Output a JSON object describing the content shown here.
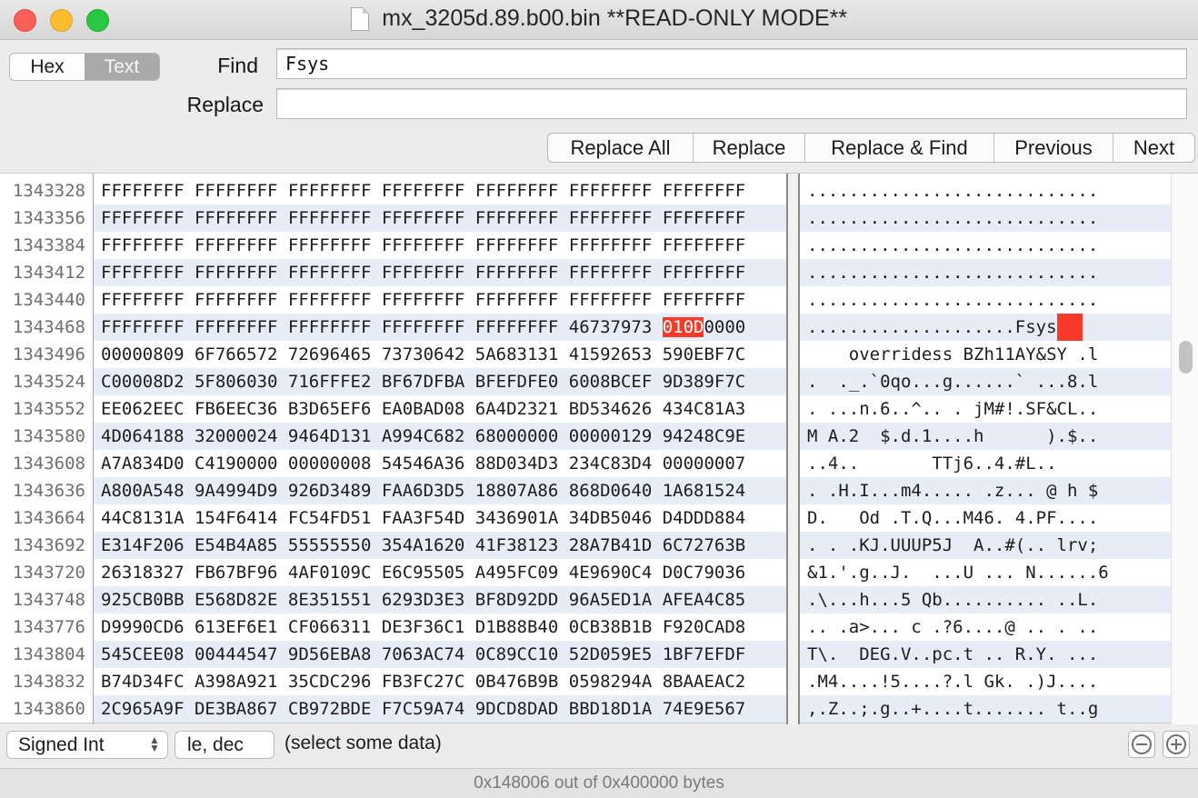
{
  "window": {
    "title": "mx_3205d.89.b00.bin **READ-ONLY MODE**"
  },
  "toolbar": {
    "mode_hex": "Hex",
    "mode_text": "Text",
    "find_label": "Find",
    "find_value": "Fsys",
    "replace_label": "Replace",
    "replace_value": "",
    "buttons": [
      "Replace All",
      "Replace",
      "Replace & Find",
      "Previous",
      "Next"
    ]
  },
  "hex_view": {
    "rows": [
      {
        "offset": "1343328",
        "hex": "FFFFFFFF FFFFFFFF FFFFFFFF FFFFFFFF FFFFFFFF FFFFFFFF FFFFFFFF",
        "ascii": "............................"
      },
      {
        "offset": "1343356",
        "hex": "FFFFFFFF FFFFFFFF FFFFFFFF FFFFFFFF FFFFFFFF FFFFFFFF FFFFFFFF",
        "ascii": "............................"
      },
      {
        "offset": "1343384",
        "hex": "FFFFFFFF FFFFFFFF FFFFFFFF FFFFFFFF FFFFFFFF FFFFFFFF FFFFFFFF",
        "ascii": "............................"
      },
      {
        "offset": "1343412",
        "hex": "FFFFFFFF FFFFFFFF FFFFFFFF FFFFFFFF FFFFFFFF FFFFFFFF FFFFFFFF",
        "ascii": "............................"
      },
      {
        "offset": "1343440",
        "hex": "FFFFFFFF FFFFFFFF FFFFFFFF FFFFFFFF FFFFFFFF FFFFFFFF FFFFFFFF",
        "ascii": "............................"
      },
      {
        "offset": "1343468",
        "hex_pre": "FFFFFFFF FFFFFFFF FFFFFFFF FFFFFFFF FFFFFFFF 46737973 ",
        "hex_hl": "010D",
        "hex_post": "0000",
        "ascii": "....................Fsys",
        "ascii_hl": true
      },
      {
        "offset": "1343496",
        "hex": "00000809 6F766572 72696465 73730642 5A683131 41592653 590EBF7C",
        "ascii": "    overridess BZh11AY&SY .l"
      },
      {
        "offset": "1343524",
        "hex": "C00008D2 5F806030 716FFFE2 BF67DFBA BFEFDFE0 6008BCEF 9D389F7C",
        "ascii": ".  ._.`0qo...g......` ...8.l"
      },
      {
        "offset": "1343552",
        "hex": "EE062EEC FB6EEC36 B3D65EF6 EA0BAD08 6A4D2321 BD534626 434C81A3",
        "ascii": ". ...n.6..^.. . jM#!.SF&CL.."
      },
      {
        "offset": "1343580",
        "hex": "4D064188 32000024 9464D131 A994C682 68000000 00000129 94248C9E",
        "ascii": "M A.2  $.d.1....h      ).$.."
      },
      {
        "offset": "1343608",
        "hex": "A7A834D0 C4190000 00000008 54546A36 88D034D3 234C83D4 00000007",
        "ascii": "..4..       TTj6..4.#L..    "
      },
      {
        "offset": "1343636",
        "hex": "A800A548 9A4994D9 926D3489 FAA6D3D5 18807A86 868D0640 1A681524",
        "ascii": ". .H.I...m4..... .z... @ h $"
      },
      {
        "offset": "1343664",
        "hex": "44C8131A 154F6414 FC54FD51 FAA3F54D 3436901A 34DB5046 D4DDD884",
        "ascii": "D.   Od .T.Q...M46. 4.PF...."
      },
      {
        "offset": "1343692",
        "hex": "E314F206 E54B4A85 55555550 354A1620 41F38123 28A7B41D 6C72763B",
        "ascii": ". . .KJ.UUUP5J  A..#(.. lrv;"
      },
      {
        "offset": "1343720",
        "hex": "26318327 FB67BF96 4AF0109C E6C95505 A495FC09 4E9690C4 D0C79036",
        "ascii": "&1.'.g..J.  ...U ... N......6"
      },
      {
        "offset": "1343748",
        "hex": "925CB0BB E568D82E 8E351551 6293D3E3 BF8D92DD 96A5ED1A AFEA4C85",
        "ascii": ".\\...h...5 Qb.......... ..L."
      },
      {
        "offset": "1343776",
        "hex": "D9990CD6 613EF6E1 CF066311 DE3F36C1 D1B88B40 0CB38B1B F920CAD8",
        "ascii": ".. .a>... c .?6....@ .. . .."
      },
      {
        "offset": "1343804",
        "hex": "545CEE08 00444547 9D56EBA8 7063AC74 0C89CC10 52D059E5 1BF7EFDF",
        "ascii": "T\\.  DEG.V..pc.t .. R.Y. ..."
      },
      {
        "offset": "1343832",
        "hex": "B74D34FC A398A921 35CDC296 FB3FC27C 0B476B9B 0598294A 8BAAEAC2",
        "ascii": ".M4....!5....?.l Gk. .)J...."
      },
      {
        "offset": "1343860",
        "hex": "2C965A9F DE3BA867 CB972BDE F7C59A74 9DCD8DAD BBD18D1A 74E9E567",
        "ascii": ",.Z..;.g..+....t....... t..g"
      }
    ]
  },
  "bottom_bar": {
    "type_popup": "Signed Int",
    "endian_popup": "le, dec",
    "status": "(select some data)"
  },
  "footer": {
    "text": "0x148006 out of 0x400000 bytes"
  },
  "colors": {
    "highlight": "#f83a2a",
    "alt_row": "#e7ecf7"
  }
}
